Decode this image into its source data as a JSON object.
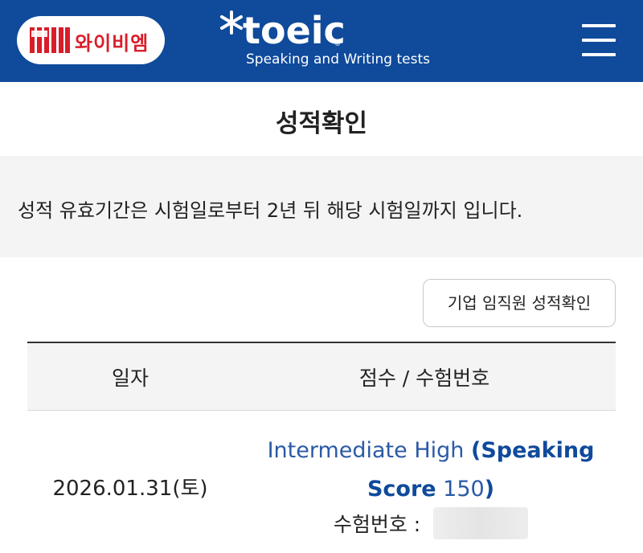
{
  "header": {
    "ybm_label": "와이비엠",
    "toeic_word": "toeic",
    "toeic_reg": "®",
    "toeic_subtitle": "Speaking and Writing tests",
    "icons": {
      "logo": "ybm-logo-mark",
      "star": "asterisk-star-icon",
      "menu": "hamburger-menu-icon"
    },
    "colors": {
      "brand_blue": "#0f4a9b",
      "ybm_red": "#d81e2a"
    }
  },
  "page": {
    "title": "성적확인"
  },
  "notice": {
    "text": "성적 유효기간은 시험일로부터 2년 뒤 해당 시험일까지 입니다."
  },
  "corp_button": {
    "label": "기업 임직원 성적확인"
  },
  "table": {
    "headers": {
      "date": "일자",
      "score": "점수 / 수험번호"
    },
    "rows": [
      {
        "date": "2026.01.31(토)",
        "level": "Intermediate High",
        "open_paren": "(",
        "speaking": "Speaking",
        "score_word": "Score",
        "score_value": "150",
        "close_paren": ")",
        "exam_no_label": "수험번호 :"
      }
    ]
  }
}
